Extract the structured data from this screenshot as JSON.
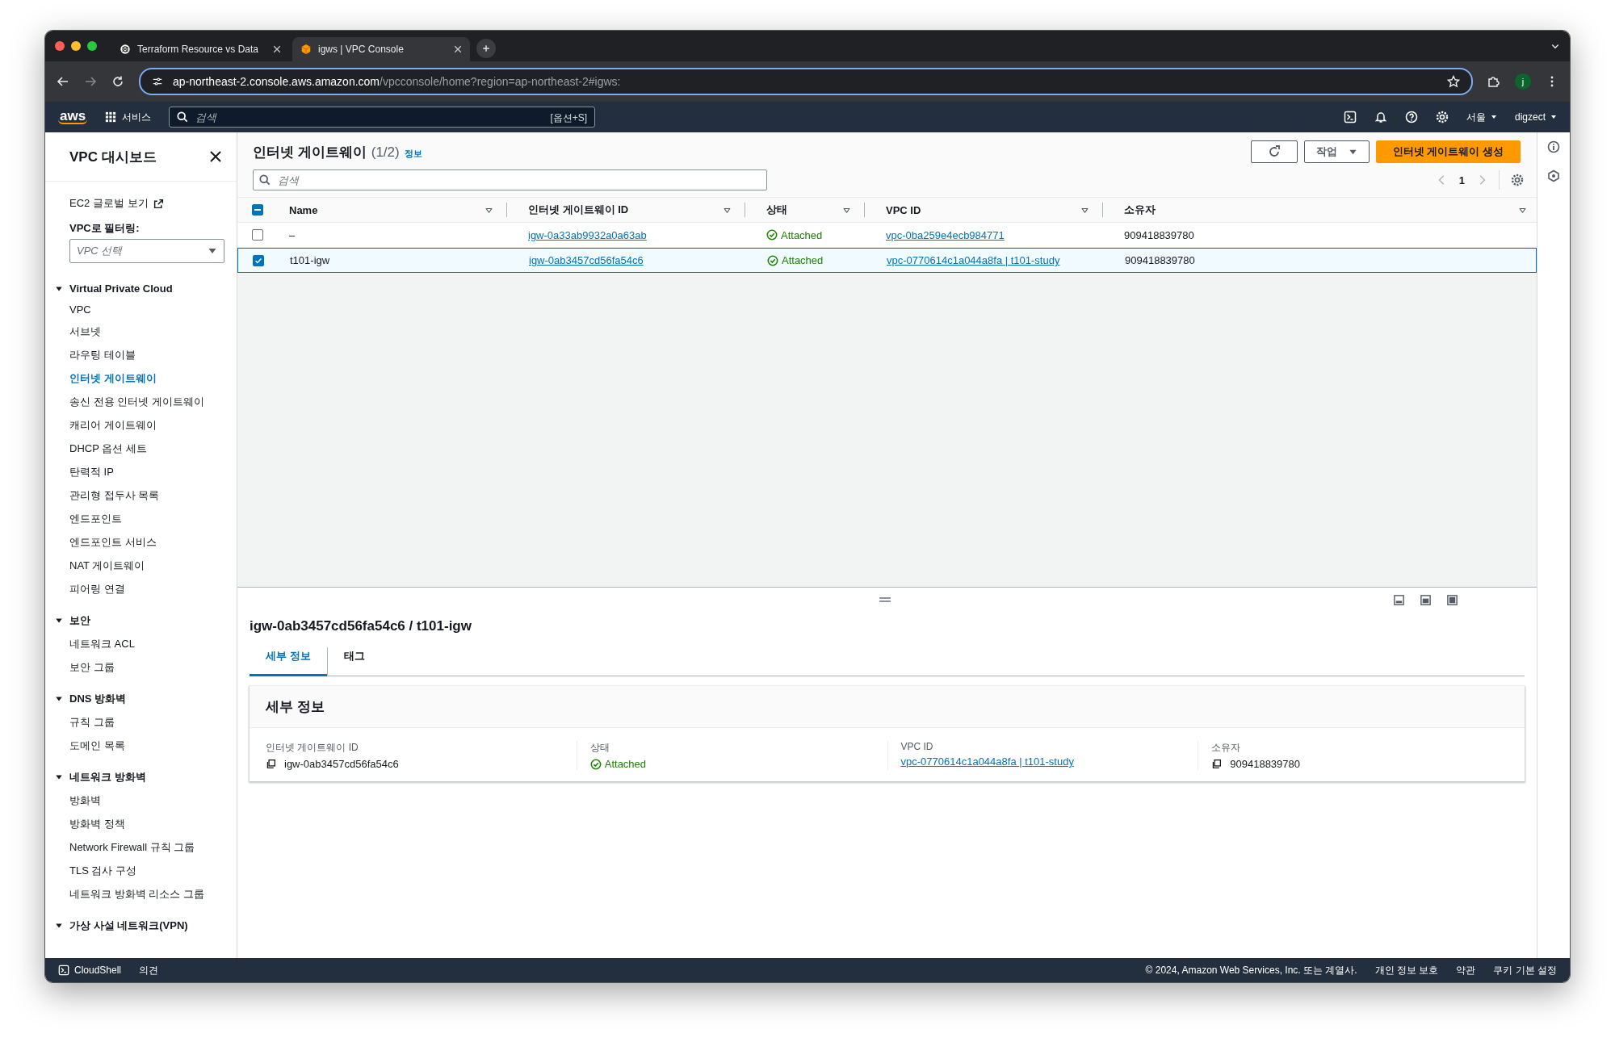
{
  "browser": {
    "tabs": [
      {
        "title": "Terraform Resource vs Data",
        "selected": false
      },
      {
        "title": "igws | VPC Console",
        "selected": true
      }
    ],
    "url": {
      "host": "ap-northeast-2.console.aws.amazon.com",
      "path": "/vpcconsole/home?region=ap-northeast-2#igws:"
    },
    "profile": "j"
  },
  "aws_nav": {
    "logo": "aws",
    "services": "서비스",
    "search_placeholder": "검색",
    "shortcut": "[옵션+S]",
    "region": "서울",
    "user": "digzect"
  },
  "sidebar": {
    "title": "VPC 대시보드",
    "global_link": "EC2 글로벌 보기",
    "filter_label": "VPC로 필터링:",
    "filter_placeholder": "VPC 선택",
    "sections": [
      {
        "title": "Virtual Private Cloud",
        "expanded": true,
        "items": [
          {
            "label": "VPC",
            "selected": false
          },
          {
            "label": "서브넷",
            "selected": false
          },
          {
            "label": "라우팅 테이블",
            "selected": false
          },
          {
            "label": "인터넷 게이트웨이",
            "selected": true
          },
          {
            "label": "송신 전용 인터넷 게이트웨이",
            "selected": false
          },
          {
            "label": "캐리어 게이트웨이",
            "selected": false
          },
          {
            "label": "DHCP 옵션 세트",
            "selected": false
          },
          {
            "label": "탄력적 IP",
            "selected": false
          },
          {
            "label": "관리형 접두사 목록",
            "selected": false
          },
          {
            "label": "엔드포인트",
            "selected": false
          },
          {
            "label": "엔드포인트 서비스",
            "selected": false
          },
          {
            "label": "NAT 게이트웨이",
            "selected": false
          },
          {
            "label": "피어링 연결",
            "selected": false
          }
        ]
      },
      {
        "title": "보안",
        "expanded": true,
        "items": [
          {
            "label": "네트워크 ACL",
            "selected": false
          },
          {
            "label": "보안 그룹",
            "selected": false
          }
        ]
      },
      {
        "title": "DNS 방화벽",
        "expanded": true,
        "items": [
          {
            "label": "규칙 그룹",
            "selected": false
          },
          {
            "label": "도메인 목록",
            "selected": false
          }
        ]
      },
      {
        "title": "네트워크 방화벽",
        "expanded": true,
        "items": [
          {
            "label": "방화벽",
            "selected": false
          },
          {
            "label": "방화벽 정책",
            "selected": false
          },
          {
            "label": "Network Firewall 규칙 그룹",
            "selected": false
          },
          {
            "label": "TLS 검사 구성",
            "selected": false
          },
          {
            "label": "네트워크 방화벽 리소스 그룹",
            "selected": false
          }
        ]
      },
      {
        "title": "가상 사설 네트워크(VPN)",
        "expanded": true
      }
    ]
  },
  "main": {
    "title": "인터넷 게이트웨이",
    "count": "(1/2)",
    "info": "정보",
    "actions_button": "작업",
    "create_button": "인터넷 게이트웨이 생성",
    "search_placeholder": "검색",
    "page": "1"
  },
  "table": {
    "header_checkbox": {
      "indeterminate": true
    },
    "columns": [
      {
        "label": "Name"
      },
      {
        "label": "인터넷 게이트웨이 ID"
      },
      {
        "label": "상태"
      },
      {
        "label": "VPC ID"
      },
      {
        "label": "소유자"
      }
    ],
    "rows": [
      {
        "selected": false,
        "name": "–",
        "id": "igw-0a33ab9932a0a63ab",
        "status": "Attached",
        "vpc": "vpc-0ba259e4ecb984771",
        "owner": "909418839780"
      },
      {
        "selected": true,
        "name": "t101-igw",
        "id": "igw-0ab3457cd56fa54c6",
        "status": "Attached",
        "vpc": "vpc-0770614c1a044a8fa | t101-study",
        "owner": "909418839780"
      }
    ]
  },
  "detail": {
    "title": "igw-0ab3457cd56fa54c6 / t101-igw",
    "tabs": [
      {
        "label": "세부 정보",
        "selected": true
      },
      {
        "label": "태그",
        "selected": false
      }
    ],
    "section_title": "세부 정보",
    "fields": [
      {
        "label": "인터넷 게이트웨이 ID",
        "value": "igw-0ab3457cd56fa54c6",
        "kind": "copy"
      },
      {
        "label": "상태",
        "value": "Attached",
        "kind": "status"
      },
      {
        "label": "VPC ID",
        "value": "vpc-0770614c1a044a8fa | t101-study",
        "kind": "link"
      },
      {
        "label": "소유자",
        "value": "909418839780",
        "kind": "copy"
      }
    ]
  },
  "footer": {
    "cloudshell": "CloudShell",
    "feedback": "의견",
    "copyright": "© 2024, Amazon Web Services, Inc. 또는 계열사.",
    "links": [
      "개인 정보 보호",
      "약관",
      "쿠키 기본 설정"
    ]
  }
}
